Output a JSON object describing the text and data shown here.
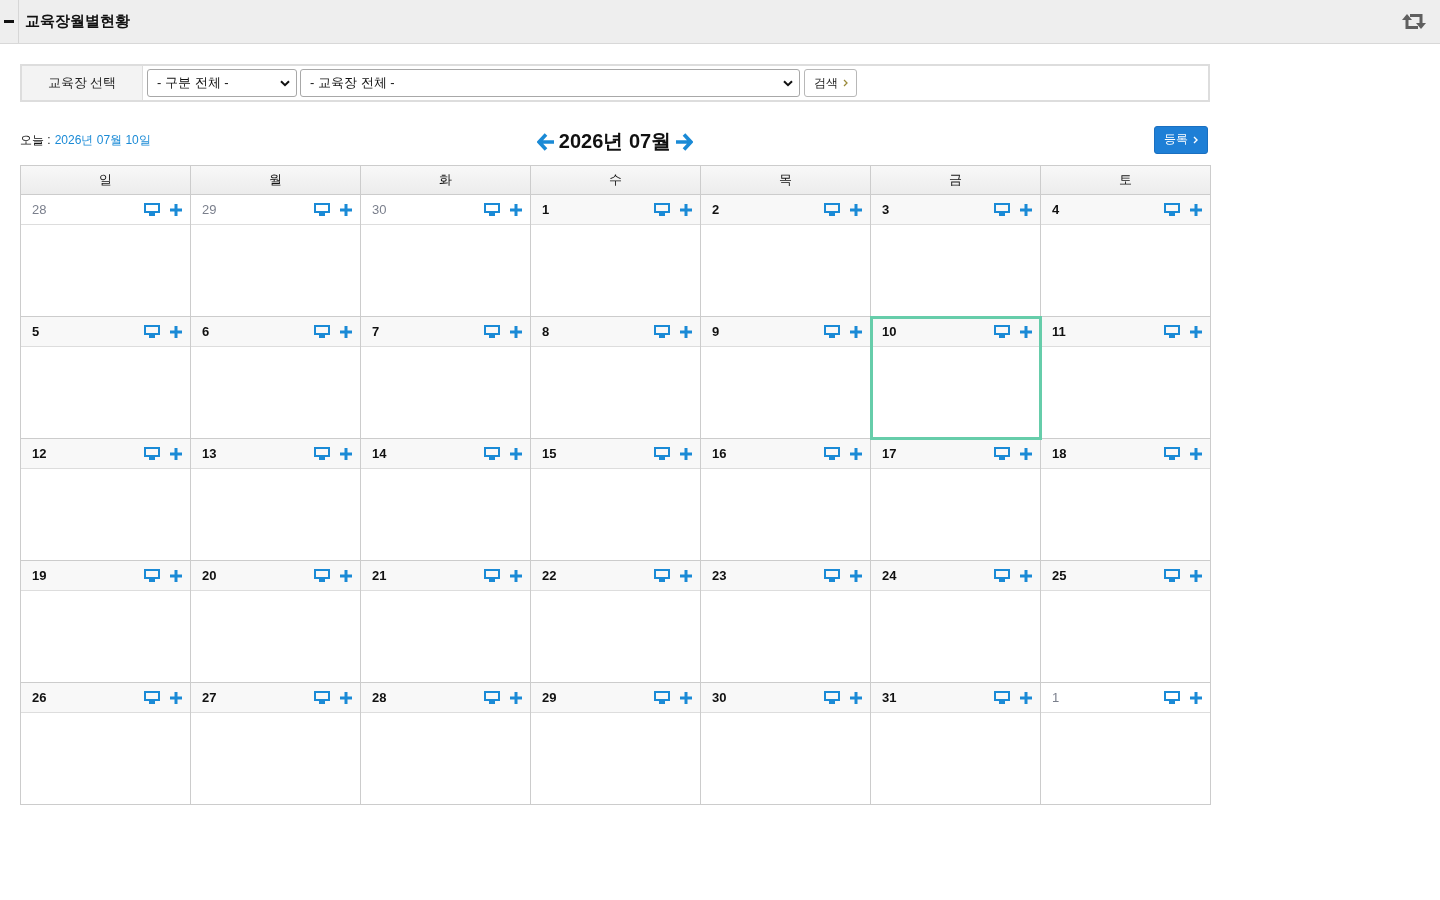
{
  "panel": {
    "title": "교육장월별현황"
  },
  "filter": {
    "label": "교육장 선택",
    "dropdowns": [
      {
        "value": "- 구분 전체 -"
      },
      {
        "value": "- 교육장 전체 -"
      }
    ],
    "search_button": "검색"
  },
  "today": {
    "label": "오늘 :",
    "date": "2026년 07월 10일"
  },
  "month_title": "2026년 07월",
  "register_button": "등록",
  "calendar": {
    "weekdays": [
      "일",
      "월",
      "화",
      "수",
      "목",
      "금",
      "토"
    ],
    "weeks": [
      [
        {
          "day": "28",
          "in_month": false,
          "today": false
        },
        {
          "day": "29",
          "in_month": false,
          "today": false
        },
        {
          "day": "30",
          "in_month": false,
          "today": false
        },
        {
          "day": "1",
          "in_month": true,
          "today": false
        },
        {
          "day": "2",
          "in_month": true,
          "today": false
        },
        {
          "day": "3",
          "in_month": true,
          "today": false
        },
        {
          "day": "4",
          "in_month": true,
          "today": false
        }
      ],
      [
        {
          "day": "5",
          "in_month": true,
          "today": false
        },
        {
          "day": "6",
          "in_month": true,
          "today": false
        },
        {
          "day": "7",
          "in_month": true,
          "today": false
        },
        {
          "day": "8",
          "in_month": true,
          "today": false
        },
        {
          "day": "9",
          "in_month": true,
          "today": false
        },
        {
          "day": "10",
          "in_month": true,
          "today": true
        },
        {
          "day": "11",
          "in_month": true,
          "today": false
        }
      ],
      [
        {
          "day": "12",
          "in_month": true,
          "today": false
        },
        {
          "day": "13",
          "in_month": true,
          "today": false
        },
        {
          "day": "14",
          "in_month": true,
          "today": false
        },
        {
          "day": "15",
          "in_month": true,
          "today": false
        },
        {
          "day": "16",
          "in_month": true,
          "today": false
        },
        {
          "day": "17",
          "in_month": true,
          "today": false
        },
        {
          "day": "18",
          "in_month": true,
          "today": false
        }
      ],
      [
        {
          "day": "19",
          "in_month": true,
          "today": false
        },
        {
          "day": "20",
          "in_month": true,
          "today": false
        },
        {
          "day": "21",
          "in_month": true,
          "today": false
        },
        {
          "day": "22",
          "in_month": true,
          "today": false
        },
        {
          "day": "23",
          "in_month": true,
          "today": false
        },
        {
          "day": "24",
          "in_month": true,
          "today": false
        },
        {
          "day": "25",
          "in_month": true,
          "today": false
        }
      ],
      [
        {
          "day": "26",
          "in_month": true,
          "today": false
        },
        {
          "day": "27",
          "in_month": true,
          "today": false
        },
        {
          "day": "28",
          "in_month": true,
          "today": false
        },
        {
          "day": "29",
          "in_month": true,
          "today": false
        },
        {
          "day": "30",
          "in_month": true,
          "today": false
        },
        {
          "day": "31",
          "in_month": true,
          "today": false
        },
        {
          "day": "1",
          "in_month": false,
          "today": false
        }
      ]
    ]
  }
}
